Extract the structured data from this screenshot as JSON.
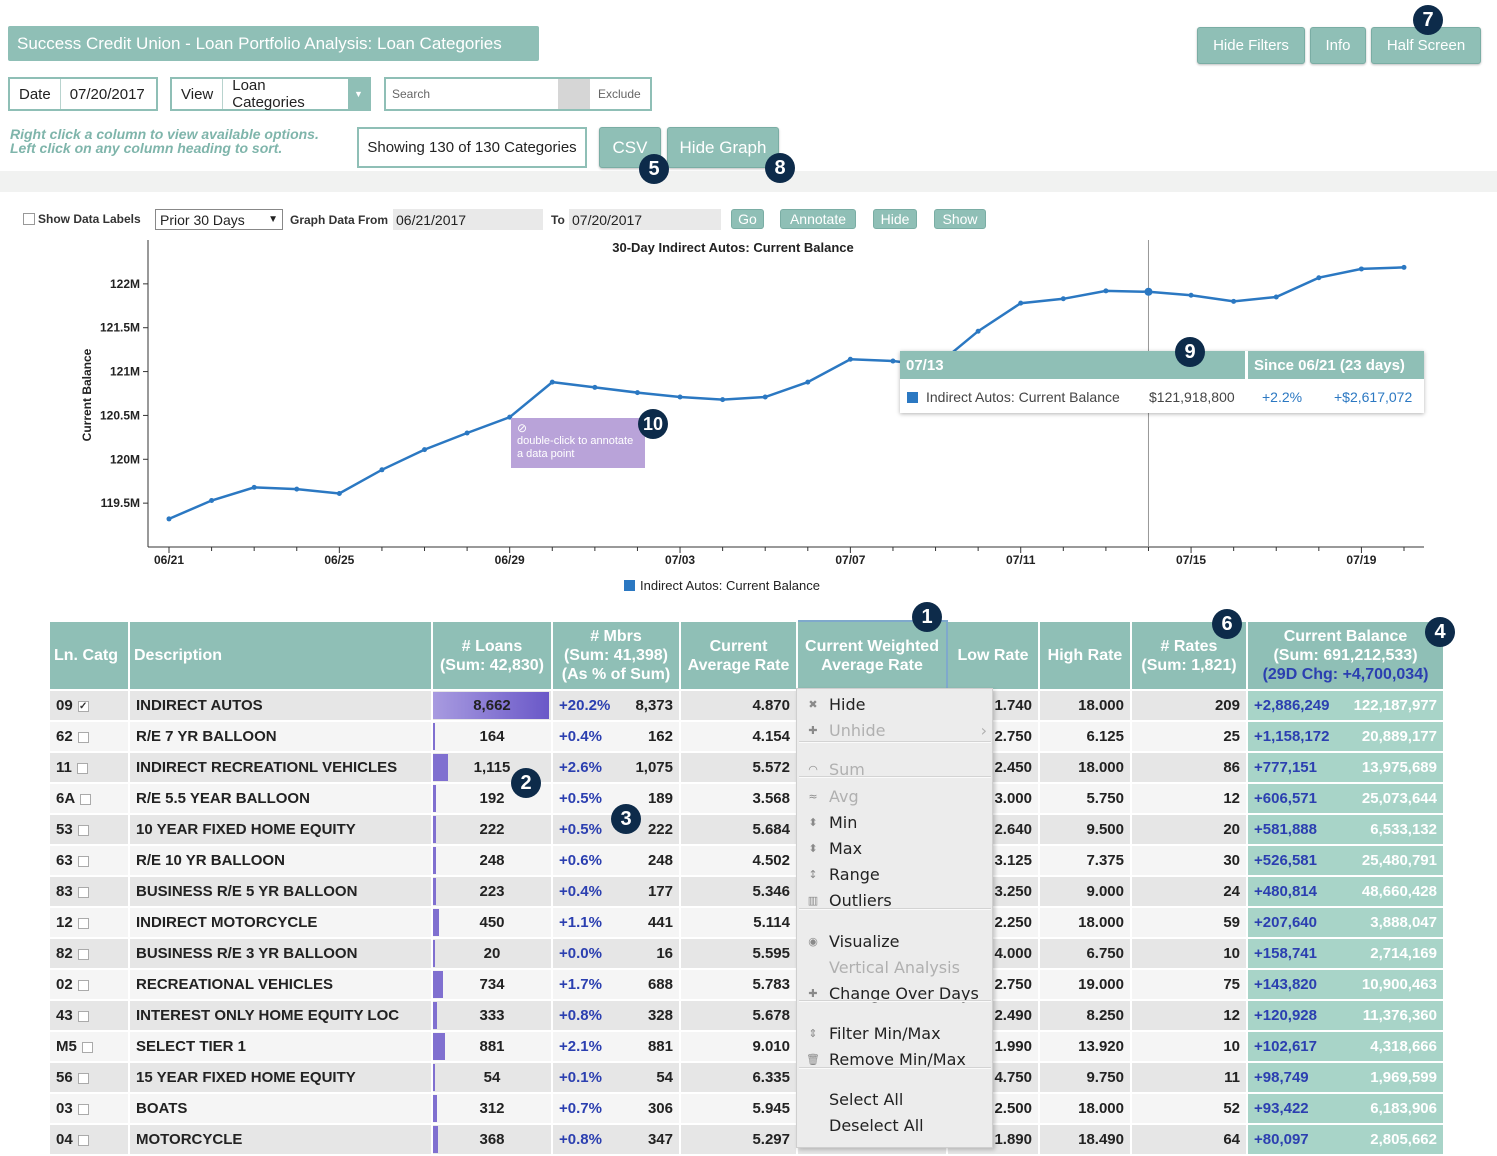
{
  "header": {
    "title": "Success Credit Union - Loan Portfolio Analysis: Loan Categories",
    "buttons": {
      "hide_filters": "Hide Filters",
      "info": "Info",
      "half_screen": "Half Screen"
    }
  },
  "filters": {
    "date_label": "Date",
    "date_value": "07/20/2017",
    "view_label": "View",
    "view_value": "Loan Categories",
    "search_placeholder": "Search",
    "exclude_label": "Exclude",
    "hint_line1": "Right click a column to view available options.",
    "hint_line2": "Left click on any column heading to sort.",
    "showing": "Showing 130 of 130 Categories",
    "csv": "CSV",
    "hide_graph": "Hide Graph"
  },
  "graph_controls": {
    "show_data_labels": "Show Data Labels",
    "range_select": "Prior 30 Days",
    "graph_from_label": "Graph Data From",
    "from_value": "06/21/2017",
    "to_label": "To",
    "to_value": "07/20/2017",
    "go": "Go",
    "annotate": "Annotate",
    "hide": "Hide",
    "show": "Show"
  },
  "annotations": [
    "1",
    "2",
    "3",
    "4",
    "5",
    "6",
    "7",
    "8",
    "9",
    "10"
  ],
  "chart_data": {
    "type": "line",
    "title": "30-Day Indirect Autos: Current Balance",
    "ylabel": "Current Balance",
    "xlabel": "",
    "ylim": [
      119000000,
      122500000
    ],
    "yticks": [
      "119.5M",
      "120M",
      "120.5M",
      "121M",
      "121.5M",
      "122M"
    ],
    "xticks": [
      "06/21",
      "06/25",
      "06/29",
      "07/03",
      "07/07",
      "07/11",
      "07/15",
      "07/19"
    ],
    "legend": "Indirect Autos: Current Balance",
    "series": [
      {
        "name": "Indirect Autos: Current Balance",
        "x": [
          "06/21",
          "06/22",
          "06/23",
          "06/24",
          "06/25",
          "06/26",
          "06/27",
          "06/28",
          "06/29",
          "06/30",
          "07/01",
          "07/02",
          "07/03",
          "07/04",
          "07/05",
          "07/06",
          "07/07",
          "07/08",
          "07/09",
          "07/10",
          "07/11",
          "07/12",
          "07/13",
          "07/14",
          "07/15",
          "07/16",
          "07/17",
          "07/18",
          "07/19",
          "07/20"
        ],
        "values": [
          119320000,
          119530000,
          119680000,
          119660000,
          119610000,
          119880000,
          120110000,
          120300000,
          120480000,
          120880000,
          120820000,
          120760000,
          120710000,
          120680000,
          120710000,
          120880000,
          121140000,
          121120000,
          121060000,
          121460000,
          121780000,
          121830000,
          121920000,
          121910000,
          121870000,
          121800000,
          121850000,
          122070000,
          122170000,
          122187977
        ]
      }
    ],
    "color": "#2b78c2"
  },
  "tooltip": {
    "date": "07/13",
    "since": "Since 06/21 (23 days)",
    "series": "Indirect Autos: Current Balance",
    "value": "$121,918,800",
    "pct": "+2.2%",
    "change": "+$2,617,072"
  },
  "annot_tip": {
    "line1": "double-click to annotate",
    "line2": "a data point"
  },
  "table": {
    "headers": {
      "ln_catg": "Ln. Catg",
      "description": "Description",
      "loans1": "# Loans",
      "loans2": "(Sum: 42,830)",
      "mbrs1": "# Mbrs",
      "mbrs2": "(Sum: 41,398)",
      "mbrs3": "(As % of Sum)",
      "car1": "Current",
      "car2": "Average Rate",
      "cwar1": "Current Weighted",
      "cwar2": "Average Rate",
      "low": "Low Rate",
      "high": "High Rate",
      "rates1": "# Rates",
      "rates2": "(Sum: 1,821)",
      "bal1": "Current Balance",
      "bal2": "(Sum: 691,212,533)",
      "bal3": "(29D Chg: +4,700,034)"
    },
    "rows": [
      {
        "code": "09",
        "checked": true,
        "desc": "INDIRECT AUTOS",
        "loans": "8,662",
        "loan_frac": 1.0,
        "pct": "+20.2%",
        "mbrs": "8,373",
        "avg": "4.870",
        "low": "1.740",
        "high": "18.000",
        "rates": "209",
        "chg": "+2,886,249",
        "bal": "122,187,977"
      },
      {
        "code": "62",
        "checked": false,
        "desc": "R/E 7 YR BALLOON",
        "loans": "164",
        "loan_frac": 0.02,
        "pct": "+0.4%",
        "mbrs": "162",
        "avg": "4.154",
        "low": "2.750",
        "high": "6.125",
        "rates": "25",
        "chg": "+1,158,172",
        "bal": "20,889,177"
      },
      {
        "code": "11",
        "checked": false,
        "desc": "INDIRECT RECREATIONL VEHICLES",
        "loans": "1,115",
        "loan_frac": 0.13,
        "pct": "+2.6%",
        "mbrs": "1,075",
        "avg": "5.572",
        "low": "2.450",
        "high": "18.000",
        "rates": "86",
        "chg": "+777,151",
        "bal": "13,975,689"
      },
      {
        "code": "6A",
        "checked": false,
        "desc": "R/E 5.5 YEAR BALLOON",
        "loans": "192",
        "loan_frac": 0.022,
        "pct": "+0.5%",
        "mbrs": "189",
        "avg": "3.568",
        "low": "3.000",
        "high": "5.750",
        "rates": "12",
        "chg": "+606,571",
        "bal": "25,073,644"
      },
      {
        "code": "53",
        "checked": false,
        "desc": "10 YEAR FIXED HOME EQUITY",
        "loans": "222",
        "loan_frac": 0.026,
        "pct": "+0.5%",
        "mbrs": "222",
        "avg": "5.684",
        "low": "2.640",
        "high": "9.500",
        "rates": "20",
        "chg": "+581,888",
        "bal": "6,533,132"
      },
      {
        "code": "63",
        "checked": false,
        "desc": "R/E 10 YR BALLOON",
        "loans": "248",
        "loan_frac": 0.029,
        "pct": "+0.6%",
        "mbrs": "248",
        "avg": "4.502",
        "low": "3.125",
        "high": "7.375",
        "rates": "30",
        "chg": "+526,581",
        "bal": "25,480,791"
      },
      {
        "code": "83",
        "checked": false,
        "desc": "BUSINESS R/E 5 YR BALLOON",
        "loans": "223",
        "loan_frac": 0.026,
        "pct": "+0.4%",
        "mbrs": "177",
        "avg": "5.346",
        "low": "3.250",
        "high": "9.000",
        "rates": "24",
        "chg": "+480,814",
        "bal": "48,660,428"
      },
      {
        "code": "12",
        "checked": false,
        "desc": "INDIRECT MOTORCYCLE",
        "loans": "450",
        "loan_frac": 0.052,
        "pct": "+1.1%",
        "mbrs": "441",
        "avg": "5.114",
        "low": "2.250",
        "high": "18.000",
        "rates": "59",
        "chg": "+207,640",
        "bal": "3,888,047"
      },
      {
        "code": "82",
        "checked": false,
        "desc": "BUSINESS R/E 3 YR BALLOON",
        "loans": "20",
        "loan_frac": 0.0,
        "pct": "+0.0%",
        "mbrs": "16",
        "avg": "5.595",
        "low": "4.000",
        "high": "6.750",
        "rates": "10",
        "chg": "+158,741",
        "bal": "2,714,169"
      },
      {
        "code": "02",
        "checked": false,
        "desc": "RECREATIONAL VEHICLES",
        "loans": "734",
        "loan_frac": 0.085,
        "pct": "+1.7%",
        "mbrs": "688",
        "avg": "5.783",
        "low": "2.750",
        "high": "19.000",
        "rates": "75",
        "chg": "+143,820",
        "bal": "10,900,463"
      },
      {
        "code": "43",
        "checked": false,
        "desc": "INTEREST ONLY HOME EQUITY LOC",
        "loans": "333",
        "loan_frac": 0.038,
        "pct": "+0.8%",
        "mbrs": "328",
        "avg": "5.678",
        "low": "2.490",
        "high": "8.250",
        "rates": "12",
        "chg": "+120,928",
        "bal": "11,376,360"
      },
      {
        "code": "M5",
        "checked": false,
        "desc": "SELECT TIER 1",
        "loans": "881",
        "loan_frac": 0.1,
        "pct": "+2.1%",
        "mbrs": "881",
        "avg": "9.010",
        "low": "1.990",
        "high": "13.920",
        "rates": "10",
        "chg": "+102,617",
        "bal": "4,318,666"
      },
      {
        "code": "56",
        "checked": false,
        "desc": "15 YEAR FIXED HOME EQUITY",
        "loans": "54",
        "loan_frac": 0.006,
        "pct": "+0.1%",
        "mbrs": "54",
        "avg": "6.335",
        "low": "4.750",
        "high": "9.750",
        "rates": "11",
        "chg": "+98,749",
        "bal": "1,969,599"
      },
      {
        "code": "03",
        "checked": false,
        "desc": "BOATS",
        "loans": "312",
        "loan_frac": 0.036,
        "pct": "+0.7%",
        "mbrs": "306",
        "avg": "5.945",
        "low": "2.500",
        "high": "18.000",
        "rates": "52",
        "chg": "+93,422",
        "bal": "6,183,906"
      },
      {
        "code": "04",
        "checked": false,
        "desc": "MOTORCYCLE",
        "loans": "368",
        "loan_frac": 0.042,
        "pct": "+0.8%",
        "mbrs": "347",
        "avg": "5.297",
        "low": "1.890",
        "high": "18.490",
        "rates": "64",
        "chg": "+80,097",
        "bal": "2,805,662"
      }
    ]
  },
  "context_menu": {
    "items": [
      {
        "label": "Hide",
        "icon": "✖",
        "disabled": false
      },
      {
        "label": "Unhide",
        "icon": "✚",
        "disabled": true,
        "arrow": "›"
      },
      {
        "label": "Sum",
        "icon": "◠",
        "disabled": true
      },
      {
        "label": "Avg",
        "icon": "≈",
        "disabled": true
      },
      {
        "label": "Min",
        "icon": "⬍",
        "disabled": false
      },
      {
        "label": "Max",
        "icon": "⬍",
        "disabled": false
      },
      {
        "label": "Range",
        "icon": "↕",
        "disabled": false
      },
      {
        "label": "Outliers",
        "icon": "▥",
        "disabled": false
      },
      {
        "label": "Visualize",
        "icon": "◉",
        "disabled": false
      },
      {
        "label": "Vertical Analysis",
        "icon": "",
        "disabled": true
      },
      {
        "label": "Change Over Days",
        "icon": "✚",
        "disabled": false
      },
      {
        "label": "Filter Min/Max",
        "icon": "⇕",
        "disabled": false
      },
      {
        "label": "Remove Min/Max",
        "icon": "🗑",
        "disabled": false
      },
      {
        "label": "Select All",
        "icon": "",
        "disabled": false
      },
      {
        "label": "Deselect All",
        "icon": "",
        "disabled": false
      }
    ]
  }
}
